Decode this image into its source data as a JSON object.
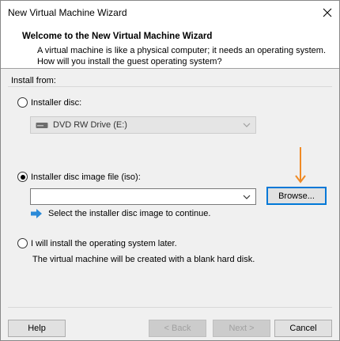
{
  "window": {
    "title": "New Virtual Machine Wizard"
  },
  "header": {
    "title": "Welcome to the New Virtual Machine Wizard",
    "description": "A virtual machine is like a physical computer; it needs an operating system. How will you install the guest operating system?"
  },
  "install": {
    "label": "Install from:",
    "options": [
      {
        "label": "Installer disc:",
        "selected": false
      },
      {
        "label": "Installer disc image file (iso):",
        "selected": true
      },
      {
        "label": "I will install the operating system later.",
        "selected": false
      }
    ],
    "disc_drive": "DVD RW Drive (E:)",
    "iso_path": "",
    "browse_label": "Browse...",
    "hint": "Select the installer disc image to continue.",
    "later_description": "The virtual machine will be created with a blank hard disk."
  },
  "footer": {
    "help": "Help",
    "back": "< Back",
    "next": "Next >",
    "cancel": "Cancel"
  },
  "colors": {
    "accent": "#0078d7",
    "annotation_arrow": "#f08a24"
  }
}
